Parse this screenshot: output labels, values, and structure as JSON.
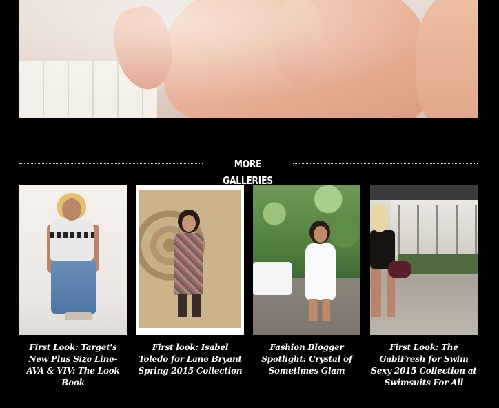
{
  "section": {
    "heading": "MORE GALLERIES"
  },
  "galleries": [
    {
      "title": "First Look: Target's New Plus Size Line- AVA & VIV: The Look Book"
    },
    {
      "title": "First look: Isabel Toledo for Lane Bryant Spring 2015 Collection"
    },
    {
      "title": "Fashion Blogger Spotlight: Crystal of Sometimes Glam"
    },
    {
      "title": "First Look: The GabiFresh for Swim Sexy 2015 Collection at Swimsuits For All"
    }
  ],
  "colors": {
    "background": "#000000",
    "text": "#ffffff",
    "divider": "#cfcfcf"
  }
}
